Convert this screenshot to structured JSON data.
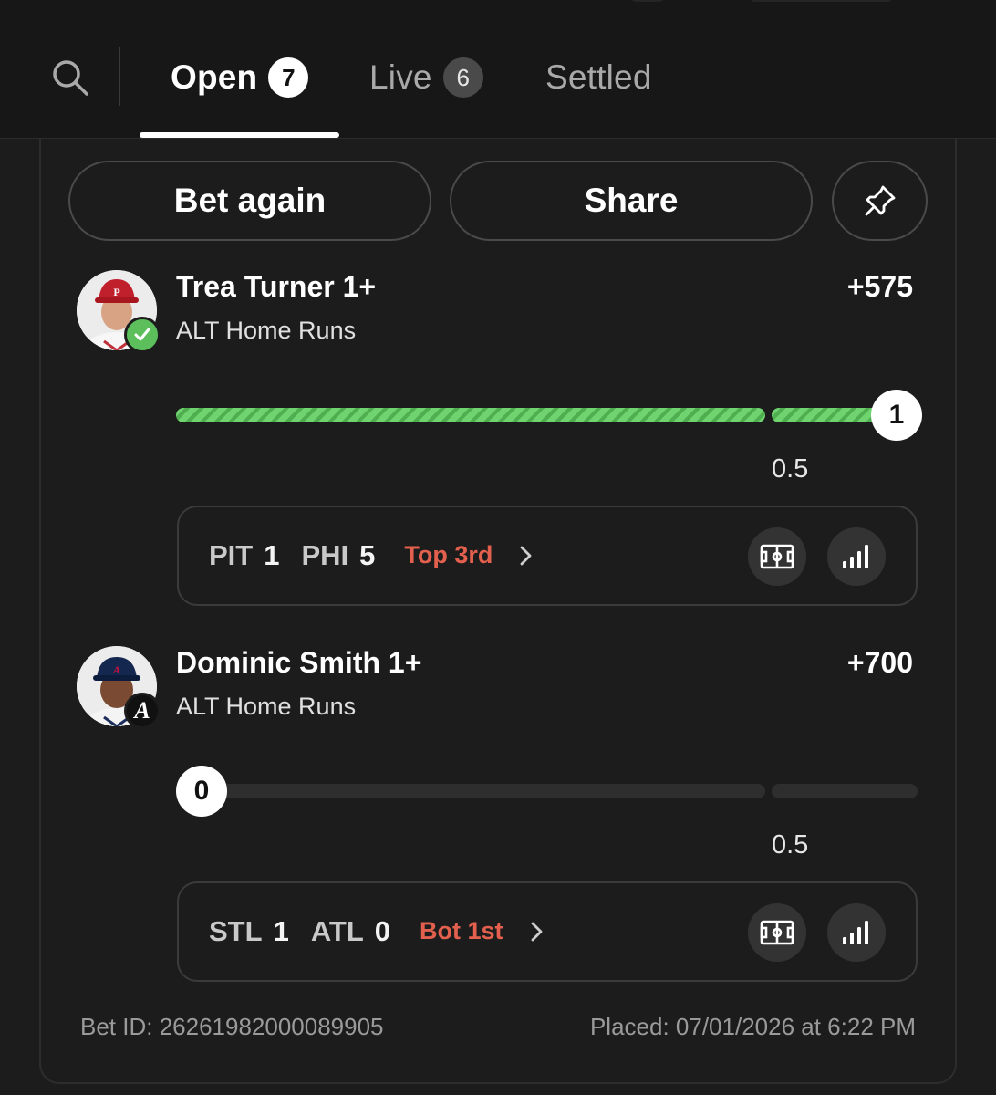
{
  "header": {
    "tabs": [
      {
        "label": "Open",
        "count": "7"
      },
      {
        "label": "Live",
        "count": "6"
      },
      {
        "label": "Settled"
      }
    ],
    "active_tab": "Open"
  },
  "actions": {
    "bet_again_label": "Bet again",
    "share_label": "Share"
  },
  "legs": [
    {
      "title": "Trea Turner 1+",
      "market": "ALT Home Runs",
      "odds": "+575",
      "current_value": "1",
      "line": "0.5",
      "status": "won",
      "game": {
        "away_team": "PIT",
        "away_score": "1",
        "home_team": "PHI",
        "home_score": "5",
        "inning": "Top 3rd"
      }
    },
    {
      "title": "Dominic Smith 1+",
      "market": "ALT Home Runs",
      "odds": "+700",
      "current_value": "0",
      "line": "0.5",
      "status": "pending",
      "badge_letter": "A",
      "game": {
        "away_team": "STL",
        "away_score": "1",
        "home_team": "ATL",
        "home_score": "0",
        "inning": "Bot 1st"
      }
    }
  ],
  "footer": {
    "bet_id": "Bet ID: 26261982000089905",
    "placed": "Placed: 07/01/2026 at 6:22 PM"
  },
  "colors": {
    "background": "#1c1c1c",
    "progress_hit": "#6fd36f",
    "inning_text": "#e2604d",
    "check_badge": "#5cbf5c"
  },
  "icons": [
    "search-icon",
    "pin-icon",
    "check-icon",
    "chevron-right-icon",
    "field-icon",
    "stats-icon"
  ]
}
